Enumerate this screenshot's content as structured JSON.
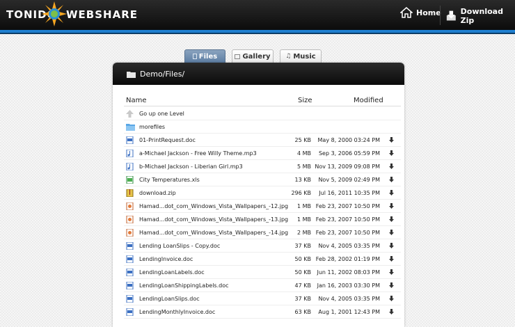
{
  "header": {
    "logo_left": "TONIDO",
    "logo_right": "WEBSHARE",
    "home_label": "Home",
    "zip_label": "Download Zip"
  },
  "tabs": [
    {
      "label": "Files",
      "active": true
    },
    {
      "label": "Gallery",
      "active": false
    },
    {
      "label": "Music",
      "active": false
    }
  ],
  "path": "Demo/Files/",
  "columns": {
    "name": "Name",
    "size": "Size",
    "modified": "Modified"
  },
  "rows": [
    {
      "name": "Go up one Level",
      "size": "",
      "modified": "",
      "icon": "up-arrow-icon",
      "download": false
    },
    {
      "name": "morefiles",
      "size": "",
      "modified": "",
      "icon": "folder-icon",
      "download": false
    },
    {
      "name": "01-PrintRequest.doc",
      "size": "25 KB",
      "modified": "May 8, 2000 03:24 PM",
      "icon": "doc-icon",
      "download": true
    },
    {
      "name": "a-Michael Jackson - Free Willy Theme.mp3",
      "size": "4 MB",
      "modified": "Sep 3, 2006 05:59 PM",
      "icon": "audio-icon",
      "download": true
    },
    {
      "name": "b-Michael Jackson - Liberian Girl.mp3",
      "size": "5 MB",
      "modified": "Nov 13, 2009 09:08 PM",
      "icon": "audio-icon",
      "download": true
    },
    {
      "name": "City Temperatures.xls",
      "size": "13 KB",
      "modified": "Nov 5, 2009 02:49 PM",
      "icon": "xls-icon",
      "download": true
    },
    {
      "name": "download.zip",
      "size": "296 KB",
      "modified": "Jul 16, 2011 10:35 PM",
      "icon": "zip-icon",
      "download": true
    },
    {
      "name": "Hamad...dot_com_Windows_Vista_Wallpapers_-12.jpg",
      "size": "1 MB",
      "modified": "Feb 23, 2007 10:50 PM",
      "icon": "image-icon",
      "download": true
    },
    {
      "name": "Hamad...dot_com_Windows_Vista_Wallpapers_-13.jpg",
      "size": "1 MB",
      "modified": "Feb 23, 2007 10:50 PM",
      "icon": "image-icon",
      "download": true
    },
    {
      "name": "Hamad...dot_com_Windows_Vista_Wallpapers_-14.jpg",
      "size": "2 MB",
      "modified": "Feb 23, 2007 10:50 PM",
      "icon": "image-icon",
      "download": true
    },
    {
      "name": "Lending LoanSlips - Copy.doc",
      "size": "37 KB",
      "modified": "Nov 4, 2005 03:35 PM",
      "icon": "doc-icon",
      "download": true
    },
    {
      "name": "LendingInvoice.doc",
      "size": "50 KB",
      "modified": "Feb 28, 2002 01:19 PM",
      "icon": "doc-icon",
      "download": true
    },
    {
      "name": "LendingLoanLabels.doc",
      "size": "50 KB",
      "modified": "Jun 11, 2002 08:03 PM",
      "icon": "doc-icon",
      "download": true
    },
    {
      "name": "LendingLoanShippingLabels.doc",
      "size": "47 KB",
      "modified": "Jan 16, 2003 03:30 PM",
      "icon": "doc-icon",
      "download": true
    },
    {
      "name": "LendingLoanSlips.doc",
      "size": "37 KB",
      "modified": "Nov 4, 2005 03:35 PM",
      "icon": "doc-icon",
      "download": true
    },
    {
      "name": "LendingMonthlyInvoice.doc",
      "size": "63 KB",
      "modified": "Aug 1, 2001 12:43 PM",
      "icon": "doc-icon",
      "download": true
    }
  ],
  "colors": {
    "header": "#111111",
    "accent_blue": "#1f7fd0",
    "tab_active": "#6f8db0"
  }
}
